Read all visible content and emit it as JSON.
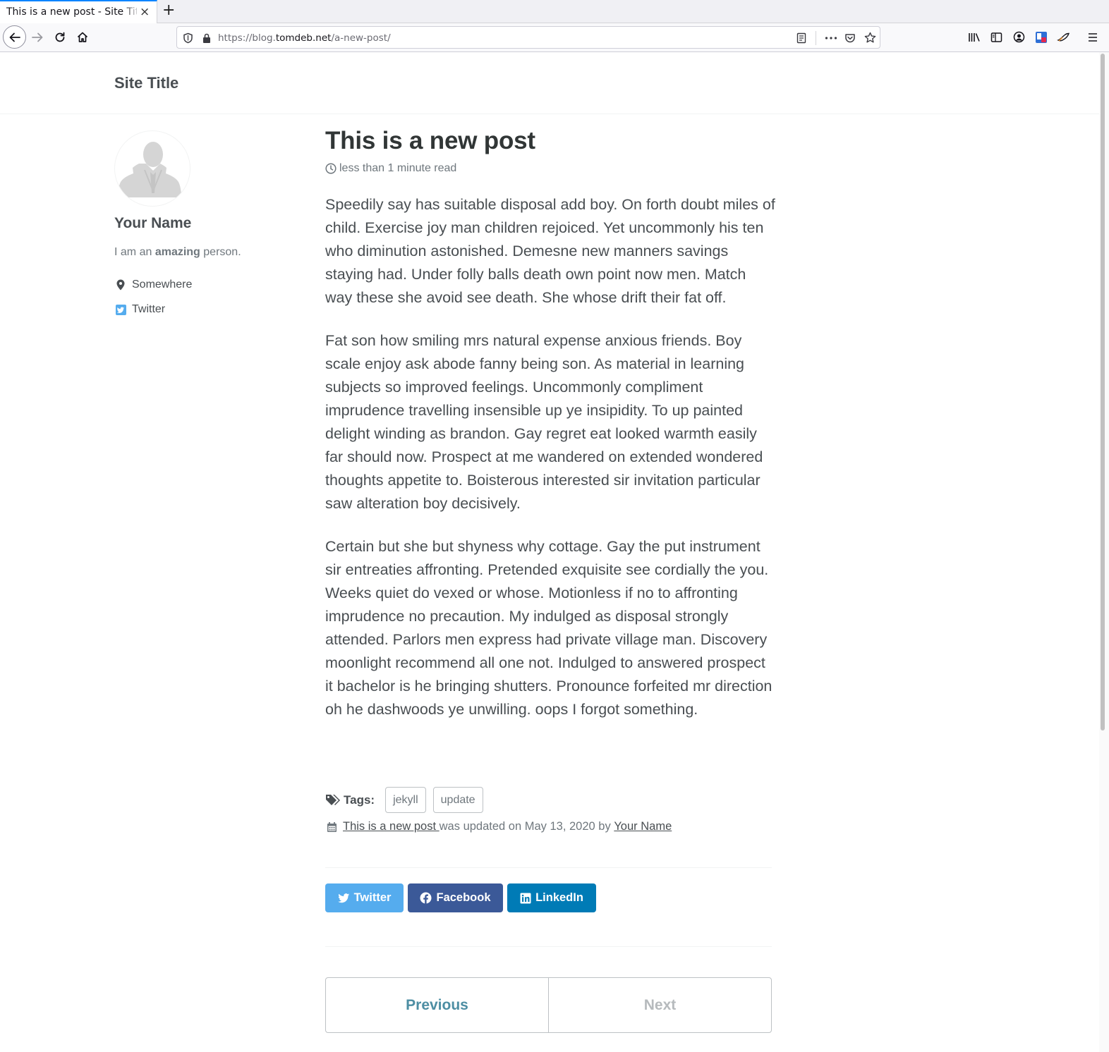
{
  "browser": {
    "tab_title": "This is a new post - Site Title",
    "tab_close": "×",
    "new_tab": "+",
    "url_prefix": "https://blog.",
    "url_domain": "tomdeb.net",
    "url_path": "/a-new-post/"
  },
  "site": {
    "title": "Site Title"
  },
  "author": {
    "name": "Your Name",
    "bio_prefix": "I am an ",
    "bio_bold": "amazing",
    "bio_suffix": " person.",
    "location": "Somewhere",
    "twitter": "Twitter"
  },
  "post": {
    "title": "This is a new post",
    "read_time": "less than 1 minute read",
    "paragraphs": [
      "Speedily say has suitable disposal add boy. On forth doubt miles of child. Exercise joy man children rejoiced. Yet uncommonly his ten who diminution astonished. Demesne new manners savings staying had. Under folly balls death own point now men. Match way these she avoid see death. She whose drift their fat off.",
      "Fat son how smiling mrs natural expense anxious friends. Boy scale enjoy ask abode fanny being son. As material in learning subjects so improved feelings. Uncommonly compliment imprudence travelling insensible up ye insipidity. To up painted delight winding as brandon. Gay regret eat looked warmth easily far should now. Prospect at me wandered on extended wondered thoughts appetite to. Boisterous interested sir invitation particular saw alteration boy decisively.",
      "Certain but she but shyness why cottage. Gay the put instrument sir entreaties affronting. Pretended exquisite see cordially the you. Weeks quiet do vexed or whose. Motionless if no to affronting imprudence no precaution. My indulged as disposal strongly attended. Parlors men express had private village man. Discovery moonlight recommend all one not. Indulged to answered prospect it bachelor is he bringing shutters. Pronounce forfeited mr direction oh he dashwoods ye unwilling. oops I forgot something."
    ],
    "tags_label": "Tags:",
    "tags": [
      "jekyll",
      "update"
    ],
    "updated_link": "This is a new post ",
    "updated_text": "was updated on May 13, 2020 by ",
    "updated_author": "Your Name"
  },
  "share": {
    "twitter": "Twitter",
    "facebook": "Facebook",
    "linkedin": "LinkedIn",
    "colors": {
      "twitter": "#55acee",
      "facebook": "#3b5998",
      "linkedin": "#007bb6"
    }
  },
  "pager": {
    "previous": "Previous",
    "next": "Next"
  },
  "icons": {
    "tab_close": "close-icon",
    "back": "arrow-left-icon",
    "forward": "arrow-right-icon",
    "reload": "reload-icon",
    "home": "home-icon",
    "shield": "shield-icon",
    "lock": "lock-icon",
    "reader": "reader-view-icon",
    "more": "more-icon",
    "pocket": "pocket-icon",
    "bookmark": "star-icon",
    "library": "library-icon",
    "sidebar": "sidebar-icon",
    "account": "account-icon",
    "menu": "hamburger-menu-icon"
  }
}
